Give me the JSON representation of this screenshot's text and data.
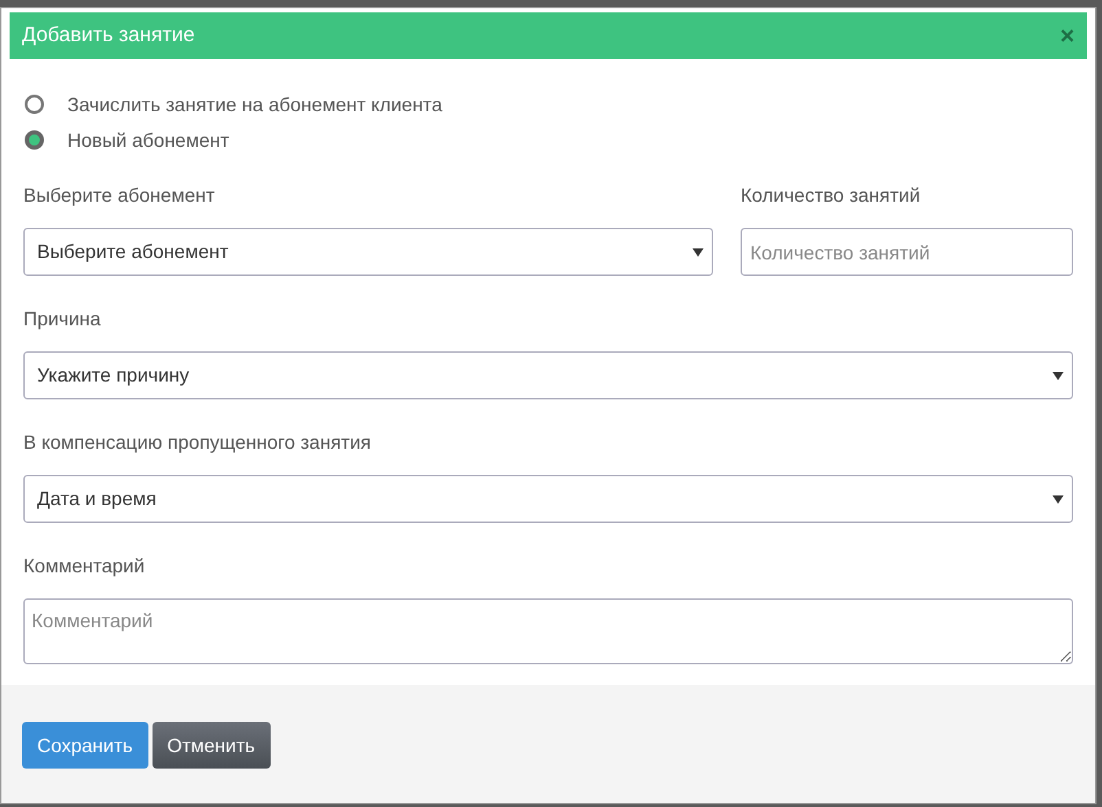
{
  "dialog": {
    "title": "Добавить занятие",
    "close": "×"
  },
  "options": [
    {
      "label": "Зачислить занятие на абонемент клиента",
      "selected": false
    },
    {
      "label": "Новый абонемент",
      "selected": true
    }
  ],
  "fields": [
    {
      "kind": "select",
      "label": "Выберите абонемент",
      "value": "Выберите абонемент"
    },
    {
      "kind": "input",
      "label": "Количество занятий",
      "placeholder": "Количество занятий"
    },
    {
      "kind": "select",
      "label": "Причина",
      "value": "Укажите причину"
    },
    {
      "kind": "select",
      "label": "В компенсацию пропущенного занятия",
      "value": "Дата и время"
    },
    {
      "kind": "textarea",
      "label": "Комментарий",
      "placeholder": "Комментарий"
    }
  ],
  "buttons": [
    {
      "label": "Сохранить",
      "kind": "primary"
    },
    {
      "label": "Отменить",
      "kind": "secondary"
    }
  ]
}
